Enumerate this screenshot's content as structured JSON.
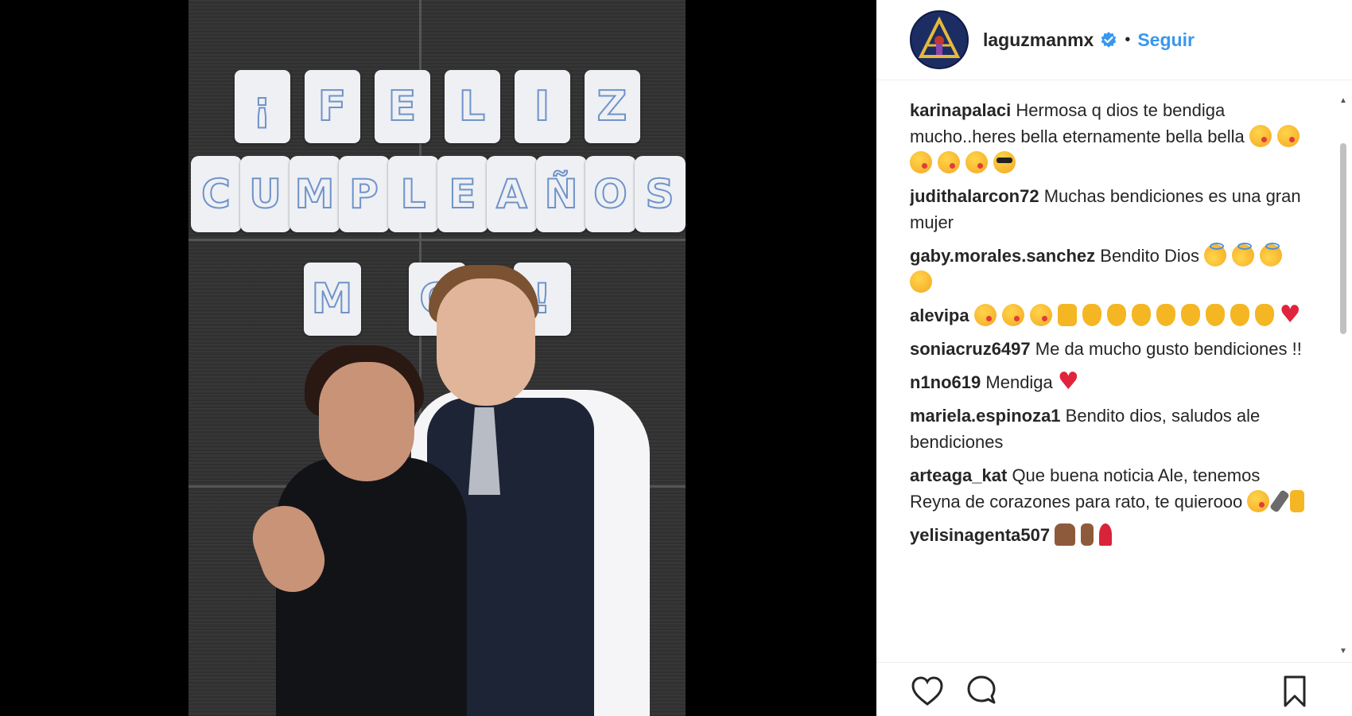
{
  "post": {
    "username": "laguzmanmx",
    "separator": "•",
    "follow_label": "Seguir",
    "verified_icon": "verified-badge-icon",
    "colors": {
      "link": "#3897f0",
      "text": "#262626"
    }
  },
  "video": {
    "banner_row1": [
      "¡",
      "F",
      "E",
      "L",
      "I",
      "Z"
    ],
    "banner_row2": [
      "C",
      "U",
      "M",
      "P",
      "L",
      "E",
      "A",
      "Ñ",
      "O",
      "S"
    ],
    "banner_row3": [
      "M",
      "O",
      "",
      "!"
    ]
  },
  "comments": [
    {
      "user": "karinapalaci",
      "text": "Hermosa q dios te bendiga mucho..heres bella eternamente bella bella",
      "emojis": [
        "kiss",
        "kiss",
        "kiss",
        "kiss",
        "kiss",
        "cool"
      ]
    },
    {
      "user": "judithalarcon72",
      "text": "Muchas bendiciones es una gran mujer",
      "emojis": []
    },
    {
      "user": "gaby.morales.sanchez",
      "text": "Bendito Dios",
      "emojis": [
        "angel",
        "angel",
        "angel",
        "blush"
      ]
    },
    {
      "user": "alevipa",
      "text": "",
      "emojis": [
        "kiss",
        "kiss",
        "kiss",
        "thumb",
        "clap",
        "clap",
        "clap",
        "clap",
        "clap",
        "clap",
        "clap",
        "clap",
        "heart"
      ]
    },
    {
      "user": "soniacruz6497",
      "text": "Me da mucho gusto bendiciones !!",
      "emojis": []
    },
    {
      "user": "n1no619",
      "text": "Mendiga",
      "emojis": [
        "heart"
      ]
    },
    {
      "user": "mariela.espinoza1",
      "text": "Bendito dios, saludos ale bendiciones",
      "emojis": []
    },
    {
      "user": "arteaga_kat",
      "text": "Que buena noticia Ale, tenemos Reyna de corazones para rato, te quierooo",
      "emojis": [
        "kiss",
        "mic",
        "horns"
      ]
    },
    {
      "user": "yelisinagenta507",
      "text": "",
      "emojis": [
        "pray",
        "point",
        "rose"
      ]
    }
  ],
  "actions": {
    "like_icon": "heart-outline-icon",
    "comment_icon": "comment-bubble-icon",
    "save_icon": "bookmark-icon"
  }
}
